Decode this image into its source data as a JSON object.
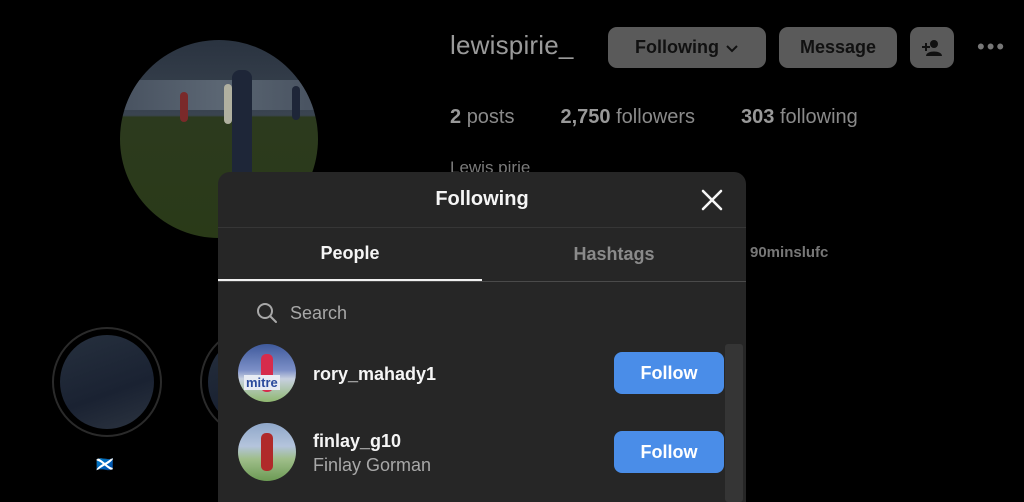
{
  "profile": {
    "username": "lewispirie_",
    "full_name": "Lewis pirie",
    "bio_link": "90minslufc",
    "highlight_label": "🏴󠁧󠁢󠁳󠁣󠁴󠁿",
    "stats": {
      "posts_count": "2",
      "posts_label": "posts",
      "followers_count": "2,750",
      "followers_label": "followers",
      "following_count": "303",
      "following_label": "following"
    },
    "buttons": {
      "following": "Following",
      "message": "Message"
    }
  },
  "modal": {
    "title": "Following",
    "tabs": [
      {
        "label": "People"
      },
      {
        "label": "Hashtags"
      }
    ],
    "search_placeholder": "Search",
    "people": [
      {
        "username": "rory_mahady1",
        "full_name": "",
        "button": "Follow",
        "avatar_text": "mitre"
      },
      {
        "username": "finlay_g10",
        "full_name": "Finlay Gorman",
        "button": "Follow"
      }
    ]
  },
  "colors": {
    "accent": "#4a8de8",
    "modal_bg": "#262626",
    "page_bg": "#000000"
  }
}
